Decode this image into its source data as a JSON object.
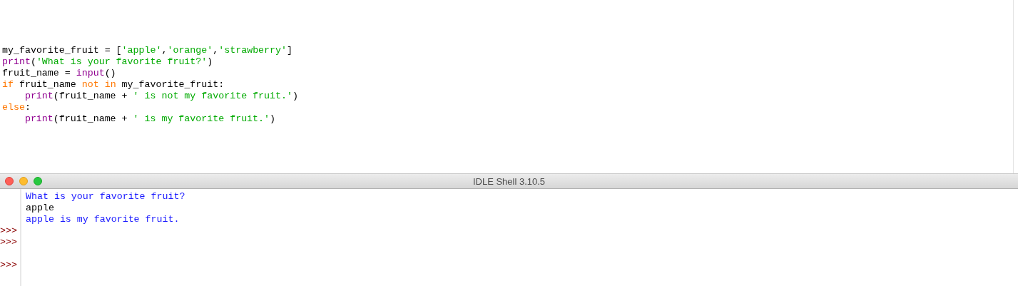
{
  "editor": {
    "lines": [
      [
        {
          "kind": "plain",
          "text": "my_favorite_fruit = ["
        },
        {
          "kind": "string",
          "text": "'apple'"
        },
        {
          "kind": "plain",
          "text": ","
        },
        {
          "kind": "string",
          "text": "'orange'"
        },
        {
          "kind": "plain",
          "text": ","
        },
        {
          "kind": "string",
          "text": "'strawberry'"
        },
        {
          "kind": "plain",
          "text": "]"
        }
      ],
      [
        {
          "kind": "builtin",
          "text": "print"
        },
        {
          "kind": "plain",
          "text": "("
        },
        {
          "kind": "string",
          "text": "'What is your favorite fruit?'"
        },
        {
          "kind": "plain",
          "text": ")"
        }
      ],
      [
        {
          "kind": "plain",
          "text": "fruit_name = "
        },
        {
          "kind": "builtin",
          "text": "input"
        },
        {
          "kind": "plain",
          "text": "()"
        }
      ],
      [
        {
          "kind": "keyword",
          "text": "if"
        },
        {
          "kind": "plain",
          "text": " fruit_name "
        },
        {
          "kind": "keyword",
          "text": "not in"
        },
        {
          "kind": "plain",
          "text": " my_favorite_fruit:"
        }
      ],
      [
        {
          "kind": "indent"
        },
        {
          "kind": "builtin",
          "text": "print"
        },
        {
          "kind": "plain",
          "text": "(fruit_name + "
        },
        {
          "kind": "string",
          "text": "' is not my favorite fruit.'"
        },
        {
          "kind": "plain",
          "text": ")"
        }
      ],
      [
        {
          "kind": "keyword",
          "text": "else"
        },
        {
          "kind": "plain",
          "text": ":"
        }
      ],
      [
        {
          "kind": "indent"
        },
        {
          "kind": "builtin",
          "text": "print"
        },
        {
          "kind": "plain",
          "text": "(fruit_name + "
        },
        {
          "kind": "string",
          "text": "' is my favorite fruit.'"
        },
        {
          "kind": "plain",
          "text": ")"
        }
      ]
    ]
  },
  "shell": {
    "title": "IDLE Shell 3.10.5",
    "lines": [
      {
        "kind": "stdout",
        "text": "What is your favorite fruit?"
      },
      {
        "kind": "input",
        "text": "apple"
      },
      {
        "kind": "stdout",
        "text": "apple is my favorite fruit."
      },
      {
        "kind": "prompt",
        "text": ">>>"
      },
      {
        "kind": "prompt",
        "text": ">>>"
      },
      {
        "kind": "empty"
      },
      {
        "kind": "prompt",
        "text": ">>>"
      }
    ]
  }
}
